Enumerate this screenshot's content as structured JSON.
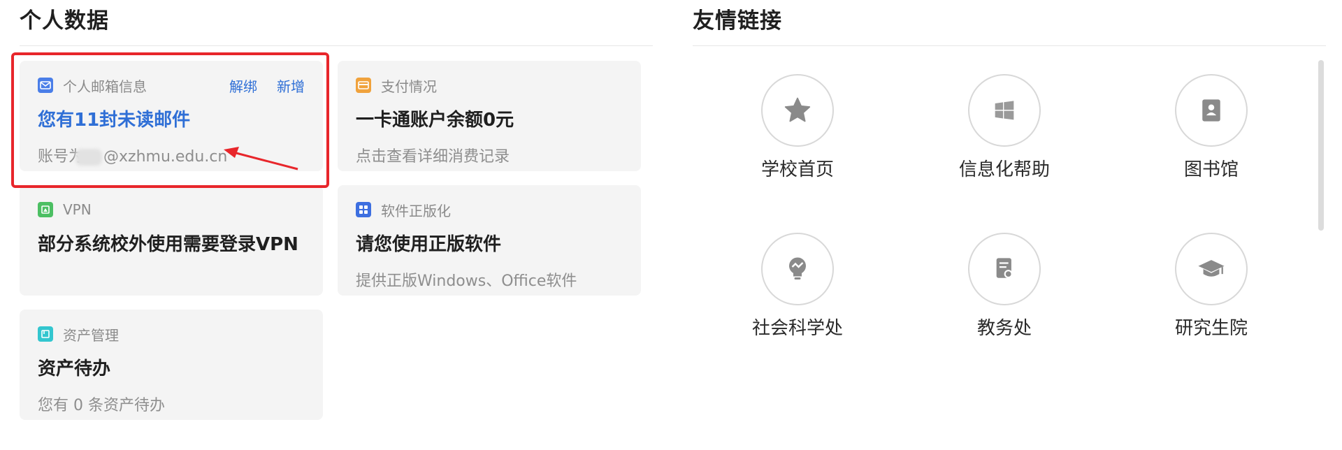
{
  "personal": {
    "title": "个人数据",
    "cards": [
      {
        "label": "个人邮箱信息",
        "actions": [
          "解绑",
          "新增"
        ],
        "title": "您有11封未读邮件",
        "sub_prefix": "账号为",
        "sub_suffix": "@xzhmu.edu.cn",
        "icon": "mail-icon",
        "color": "#4a7ee8"
      },
      {
        "label": "支付情况",
        "title": "一卡通账户余额0元",
        "sub": "点击查看详细消费记录",
        "icon": "payment-card-icon",
        "color": "#f0a23c"
      },
      {
        "label": "VPN",
        "title": "部分系统校外使用需要登录VPN",
        "sub": "",
        "icon": "vpn-icon",
        "color": "#4cbf63"
      },
      {
        "label": "软件正版化",
        "title": "请您使用正版软件",
        "sub": "提供正版Windows、Office软件",
        "icon": "apps-grid-icon",
        "color": "#3d6fe0"
      },
      {
        "label": "资产管理",
        "title": "资产待办",
        "sub": "您有 0 条资产待办",
        "icon": "asset-box-icon",
        "color": "#33c6cf"
      }
    ]
  },
  "links": {
    "title": "友情链接",
    "items": [
      {
        "label": "学校首页",
        "icon": "star-icon"
      },
      {
        "label": "信息化帮助",
        "icon": "windows-icon"
      },
      {
        "label": "图书馆",
        "icon": "contact-card-icon"
      },
      {
        "label": "社会科学处",
        "icon": "lightbulb-icon"
      },
      {
        "label": "教务处",
        "icon": "document-search-icon"
      },
      {
        "label": "研究生院",
        "icon": "graduation-cap-icon"
      }
    ]
  }
}
